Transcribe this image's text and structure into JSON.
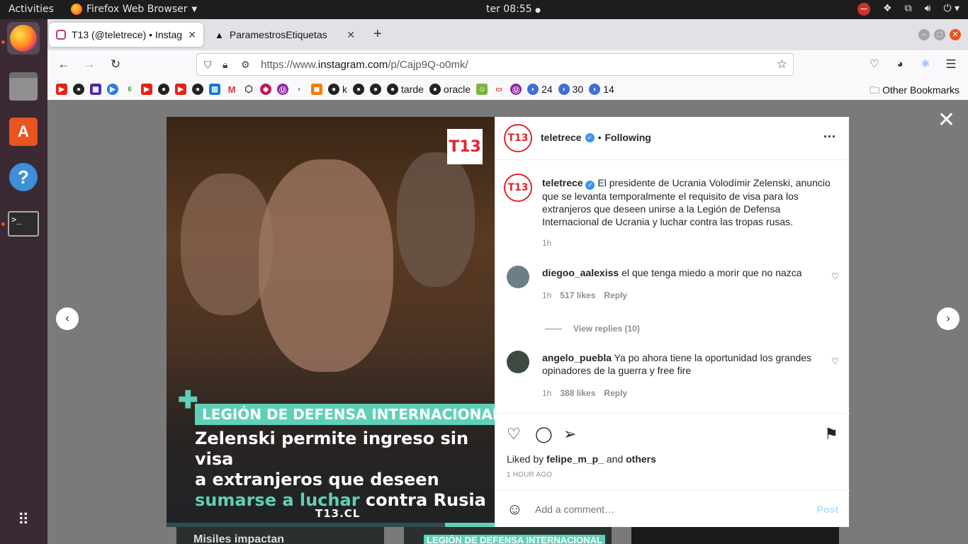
{
  "topbar": {
    "activities": "Activities",
    "app_name": "Firefox Web Browser",
    "clock": "ter 08:55"
  },
  "dock": {
    "items": [
      "firefox-icon",
      "files-icon",
      "software-center-icon",
      "help-icon",
      "terminal-icon",
      "app-grid-icon"
    ]
  },
  "tabs": [
    {
      "title": "T13 (@teletrece) • Instag",
      "icon": "instagram-icon"
    },
    {
      "title": "ParamestrosEtiquetas",
      "icon": "airtable-icon"
    }
  ],
  "navbar": {
    "url_prefix": "https://www.",
    "url_domain": "instagram.com",
    "url_path": "/p/Cajp9Q-o0mk/"
  },
  "bookmarks": {
    "labels": [
      "tarde",
      "oracle",
      "24",
      "30",
      "14",
      "k"
    ],
    "other": "Other Bookmarks"
  },
  "post": {
    "account": "teletrece",
    "follow_state": "Following",
    "caption": "El presidente de Ucrania Volodímir Zelenski, anuncio que se levanta temporalmente el requisito de visa para los extranjeros que deseen unirse a la Legión de Defensa Internacional de Ucrania y luchar contra las tropas rusas.",
    "caption_time": "1h",
    "image": {
      "logo": "T13",
      "banner": "LEGIÓN DE DEFENSA INTERNACIONAL",
      "headline_line1": "Zelenski permite ingreso sin visa",
      "headline_line2": "a extranjeros que deseen",
      "headline_accent": "sumarse a luchar",
      "headline_line3_rest": " contra Rusia",
      "site": "T13.CL"
    },
    "comments": [
      {
        "user": "diegoo_aalexiss",
        "text": "el que tenga miedo a morir que no nazca",
        "time": "1h",
        "likes": "517 likes",
        "reply": "Reply"
      },
      {
        "user": "angelo_puebla",
        "text": "Ya po ahora tiene la oportunidad los grandes opinadores de la guerra y free fire",
        "time": "1h",
        "likes": "388 likes",
        "reply": "Reply"
      }
    ],
    "view_replies": "View replies (10)",
    "liked_by_prefix": "Liked by ",
    "liked_by_user": "felipe_m_p_",
    "liked_by_and": " and ",
    "liked_by_others": "others",
    "post_time": "1 HOUR AGO",
    "comment_placeholder": "Add a comment…",
    "post_button": "Post"
  },
  "background": {
    "thumb_text_1": "Misiles impactan",
    "thumb_text_2": "LEGIÓN DE DEFENSA INTERNACIONAL"
  }
}
